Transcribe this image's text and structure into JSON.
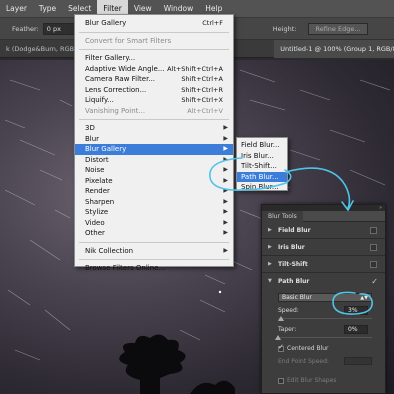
{
  "menubar": {
    "items": [
      {
        "label": "Layer"
      },
      {
        "label": "Type"
      },
      {
        "label": "Select"
      },
      {
        "label": "Filter",
        "active": true
      },
      {
        "label": "View"
      },
      {
        "label": "Window"
      },
      {
        "label": "Help"
      }
    ]
  },
  "options_bar": {
    "feather_label": "Feather:",
    "feather_value": "0 px",
    "height_label": "Height:",
    "refine_edge_label": "Refine Edge..."
  },
  "tabs": {
    "doc1": "k (Dodge&Burn, RGB/8) *",
    "doc2": "Untitled-1 @ 100% (Group 1, RGB/8) *"
  },
  "filter_menu": {
    "blur_gallery": {
      "label": "Blur Gallery",
      "shortcut": "Ctrl+F"
    },
    "convert_smart": "Convert for Smart Filters",
    "filter_gallery": "Filter Gallery...",
    "adaptive": {
      "label": "Adaptive Wide Angle...",
      "shortcut": "Alt+Shift+Ctrl+A"
    },
    "camera_raw": {
      "label": "Camera Raw Filter...",
      "shortcut": "Shift+Ctrl+A"
    },
    "lens": {
      "label": "Lens Correction...",
      "shortcut": "Shift+Ctrl+R"
    },
    "liquify": {
      "label": "Liquify...",
      "shortcut": "Shift+Ctrl+X"
    },
    "vanishing": {
      "label": "Vanishing Point...",
      "shortcut": "Alt+Ctrl+V"
    },
    "groups": [
      {
        "label": "3D"
      },
      {
        "label": "Blur"
      },
      {
        "label": "Blur Gallery",
        "highlight": true
      },
      {
        "label": "Distort"
      },
      {
        "label": "Noise"
      },
      {
        "label": "Pixelate"
      },
      {
        "label": "Render"
      },
      {
        "label": "Sharpen"
      },
      {
        "label": "Stylize"
      },
      {
        "label": "Video"
      },
      {
        "label": "Other"
      }
    ],
    "nik": "Nik Collection",
    "browse": "Browse Filters Online..."
  },
  "submenu": {
    "items": [
      {
        "label": "Field Blur..."
      },
      {
        "label": "Iris Blur..."
      },
      {
        "label": "Tilt-Shift..."
      },
      {
        "label": "Path Blur...",
        "highlight": true
      },
      {
        "label": "Spin Blur..."
      }
    ]
  },
  "blur_tools": {
    "title": "Blur Tools",
    "sections": {
      "field": "Field Blur",
      "iris": "Iris Blur",
      "tilt": "Tilt-Shift",
      "path": "Path Blur"
    },
    "dropdown_value": "Basic Blur",
    "speed_label": "Speed:",
    "speed_value": "3%",
    "speed_level": 0.03,
    "taper_label": "Taper:",
    "taper_value": "0%",
    "taper_level": 0.0,
    "centered_blur": "Centered Blur",
    "end_point_speed": "End Point Speed:",
    "edit_shapes": "Edit Blur Shapes"
  },
  "colors": {
    "highlight": "#3b7dd8",
    "annotation": "#4fc3e8"
  }
}
